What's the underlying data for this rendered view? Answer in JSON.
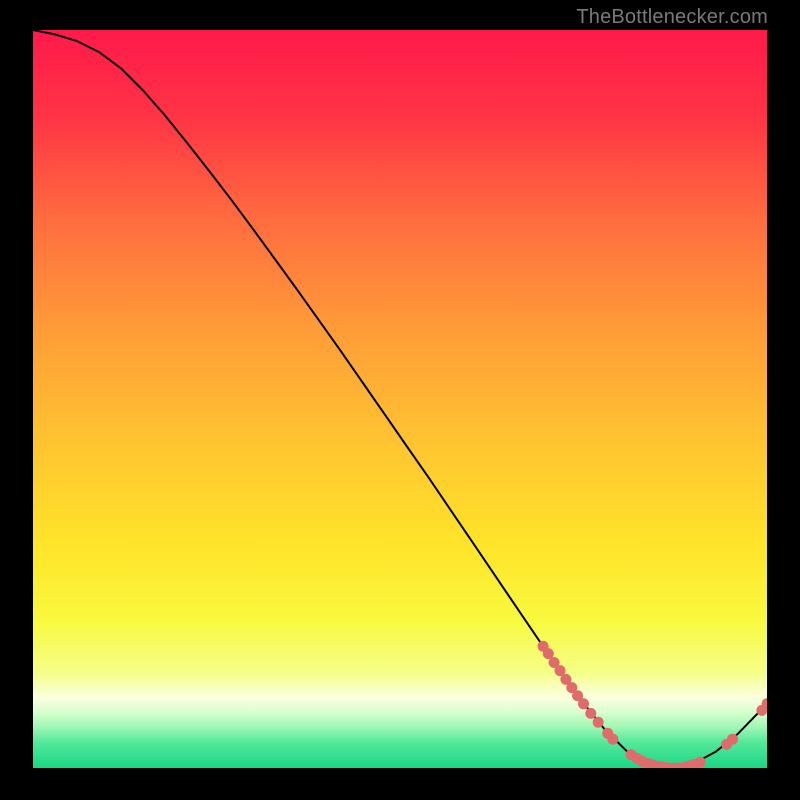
{
  "attribution": "TheBottlenecker.com",
  "chart_data": {
    "type": "line",
    "title": "",
    "xlabel": "",
    "ylabel": "",
    "xlim": [
      0,
      100
    ],
    "ylim": [
      0,
      100
    ],
    "grid": false,
    "series": [
      {
        "name": "curve",
        "x": [
          0,
          3,
          6,
          9,
          12,
          15,
          18,
          21,
          24,
          27,
          30,
          33,
          36,
          39,
          42,
          45,
          48,
          51,
          54,
          57,
          60,
          63,
          66,
          69,
          72,
          75,
          78,
          81,
          84,
          87,
          90,
          93,
          96,
          100
        ],
        "y": [
          100,
          99.4,
          98.5,
          97.0,
          94.8,
          91.8,
          88.4,
          84.7,
          80.9,
          77.0,
          73.0,
          68.9,
          64.8,
          60.6,
          56.4,
          52.1,
          47.8,
          43.5,
          39.2,
          34.8,
          30.4,
          26.0,
          21.6,
          17.2,
          12.9,
          8.8,
          5.1,
          2.2,
          0.5,
          0.0,
          0.6,
          2.2,
          4.6,
          8.7
        ]
      }
    ],
    "markers": [
      {
        "x": 69.5,
        "y": 16.5
      },
      {
        "x": 70.2,
        "y": 15.5
      },
      {
        "x": 71.0,
        "y": 14.3
      },
      {
        "x": 71.8,
        "y": 13.2
      },
      {
        "x": 72.6,
        "y": 12.0
      },
      {
        "x": 73.4,
        "y": 10.9
      },
      {
        "x": 74.2,
        "y": 9.8
      },
      {
        "x": 75.0,
        "y": 8.7
      },
      {
        "x": 76.0,
        "y": 7.4
      },
      {
        "x": 77.0,
        "y": 6.2
      },
      {
        "x": 78.3,
        "y": 4.7
      },
      {
        "x": 79.0,
        "y": 3.9
      },
      {
        "x": 81.5,
        "y": 1.8
      },
      {
        "x": 82.3,
        "y": 1.3
      },
      {
        "x": 83.0,
        "y": 0.9
      },
      {
        "x": 83.8,
        "y": 0.6
      },
      {
        "x": 84.5,
        "y": 0.4
      },
      {
        "x": 85.3,
        "y": 0.2
      },
      {
        "x": 86.0,
        "y": 0.1
      },
      {
        "x": 86.7,
        "y": 0.0
      },
      {
        "x": 87.4,
        "y": 0.0
      },
      {
        "x": 88.1,
        "y": 0.0
      },
      {
        "x": 88.8,
        "y": 0.1
      },
      {
        "x": 89.5,
        "y": 0.3
      },
      {
        "x": 90.2,
        "y": 0.5
      },
      {
        "x": 90.9,
        "y": 0.8
      },
      {
        "x": 94.5,
        "y": 3.2
      },
      {
        "x": 95.3,
        "y": 3.9
      },
      {
        "x": 99.3,
        "y": 7.8
      },
      {
        "x": 100.0,
        "y": 8.7
      }
    ],
    "background": {
      "type": "vertical-gradient",
      "stops": [
        {
          "pos": 0.0,
          "color": "#ff1a4a"
        },
        {
          "pos": 0.12,
          "color": "#ff3445"
        },
        {
          "pos": 0.25,
          "color": "#ff6a3f"
        },
        {
          "pos": 0.4,
          "color": "#ff9a38"
        },
        {
          "pos": 0.55,
          "color": "#ffc231"
        },
        {
          "pos": 0.7,
          "color": "#ffe52a"
        },
        {
          "pos": 0.8,
          "color": "#f8f93e"
        },
        {
          "pos": 0.87,
          "color": "#f5ff87"
        },
        {
          "pos": 0.905,
          "color": "#fbffe0"
        },
        {
          "pos": 0.925,
          "color": "#d6ffce"
        },
        {
          "pos": 0.945,
          "color": "#9ef7b4"
        },
        {
          "pos": 0.965,
          "color": "#54e89a"
        },
        {
          "pos": 1.0,
          "color": "#19d883"
        }
      ]
    },
    "marker_color": "#e06b6b",
    "line_color": "#000000"
  }
}
